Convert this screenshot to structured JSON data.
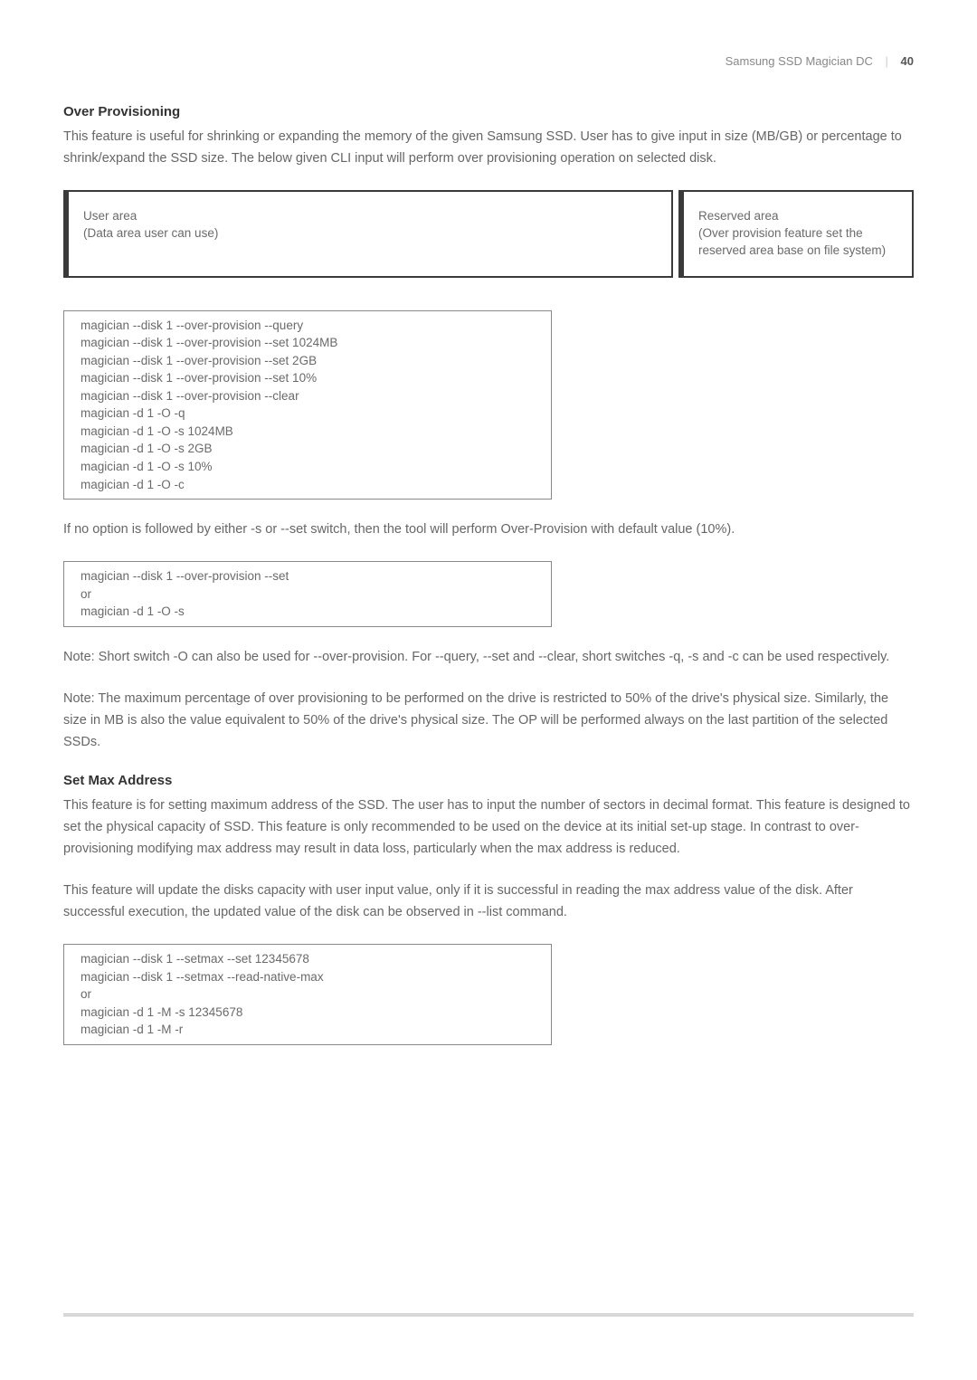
{
  "header": {
    "doc_title": "Samsung SSD Magician DC",
    "page_number": "40"
  },
  "over_provisioning": {
    "heading": "Over Provisioning",
    "intro": "This feature is useful for shrinking or expanding the memory of the given Samsung SSD. User has to give input in size (MB/GB) or percentage to shrink/expand the SSD size. The below given CLI input will perform over provisioning operation on selected disk.",
    "diagram": {
      "user_area": "User area\n(Data area user can use)",
      "reserved_area": "Reserved area\n(Over provision feature set the reserved area base on file system)"
    },
    "commands": [
      "magician --disk 1 --over-provision --query",
      "magician --disk 1 --over-provision --set 1024MB",
      "magician --disk 1 --over-provision --set 2GB",
      "magician --disk 1 --over-provision --set 10%",
      "magician --disk 1 --over-provision --clear",
      "magician -d 1 -O -q",
      "magician -d 1 -O -s 1024MB",
      "magician -d 1 -O -s 2GB",
      "magician -d 1 -O -s 10%",
      "magician -d 1 -O -c"
    ],
    "default_note": "If no option is followed by either -s or --set switch, then the tool will perform Over-Provision with default value (10%).",
    "default_commands": [
      "magician --disk 1 --over-provision --set",
      "or",
      "magician -d 1 -O -s"
    ],
    "note1": "Note: Short switch -O can also be used for --over-provision. For --query, --set and --clear, short switches -q, -s and -c can be used respectively.",
    "note2": "Note: The maximum percentage of over provisioning to be performed on the drive is restricted to 50% of the drive's physical size. Similarly, the size in MB is also the value equivalent to 50% of the drive's physical size. The OP will be performed always on the last partition of the selected SSDs."
  },
  "set_max_address": {
    "heading": "Set Max Address",
    "para1": "This feature is for setting maximum address of the SSD. The user has to input the number of sectors in decimal format. This feature is designed to set the physical capacity of SSD. This feature is only recommended to be used on the device at its initial set-up stage. In contrast to over-provisioning modifying max address may result in data loss, particularly when the max address is reduced.",
    "para2": "This feature will update the disks capacity with user input value, only if it is successful in reading the max address value of the disk. After successful execution, the updated value of the disk can be observed in --list command.",
    "commands": [
      "magician --disk 1 --setmax --set 12345678",
      "magician --disk 1 --setmax --read-native-max",
      "or",
      "magician -d 1 -M -s 12345678",
      "magician -d 1 -M -r"
    ]
  }
}
